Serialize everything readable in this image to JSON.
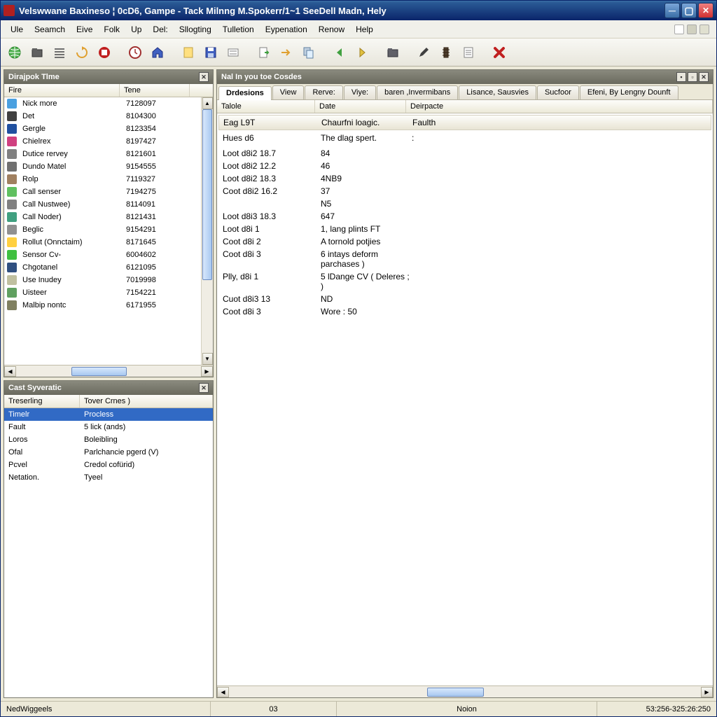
{
  "window": {
    "title": "Velswwane Baxineso ¦ 0cD6, Gampe - Tack Milnng M.Spokerr/1~1 SeeDell Madn, Hely"
  },
  "menu": [
    "Ule",
    "Seamch",
    "Eive",
    "Folk",
    "Up",
    "Del:",
    "Sllogting",
    "Tulletion",
    "Eypenation",
    "Renow",
    "Help"
  ],
  "panels": {
    "left_top": {
      "title": "Dirajpok Tlme",
      "columns": [
        "Fire",
        "Tene"
      ],
      "rows": [
        {
          "icon": "#4aa0e0",
          "name": "Nick more",
          "val": "7128097"
        },
        {
          "icon": "#404040",
          "name": "Det",
          "val": "8104300"
        },
        {
          "icon": "#2050a0",
          "name": "Gergle",
          "val": "8123354"
        },
        {
          "icon": "#d04080",
          "name": "Chielrex",
          "val": "8197427"
        },
        {
          "icon": "#808080",
          "name": "Dutice rervey",
          "val": "8121601"
        },
        {
          "icon": "#707070",
          "name": "Dundo Matel",
          "val": "9154555"
        },
        {
          "icon": "#a08060",
          "name": "Rolp",
          "val": "7119327"
        },
        {
          "icon": "#60c060",
          "name": "Call senser",
          "val": "7194275"
        },
        {
          "icon": "#808080",
          "name": "Call Nustwee)",
          "val": "8114091"
        },
        {
          "icon": "#40a080",
          "name": "Call Noder)",
          "val": "8121431"
        },
        {
          "icon": "#909090",
          "name": "Beglic",
          "val": "9154291"
        },
        {
          "icon": "#ffd040",
          "name": "Rollut (Onnctaim)",
          "val": "8171645"
        },
        {
          "icon": "#40c040",
          "name": "Sensor Cv-",
          "val": "6004602"
        },
        {
          "icon": "#305080",
          "name": "Chgotanel",
          "val": "6121095"
        },
        {
          "icon": "#c0c0a0",
          "name": "Use Inudey",
          "val": "7019998"
        },
        {
          "icon": "#60a060",
          "name": "Uisteer",
          "val": "7154221"
        },
        {
          "icon": "#808060",
          "name": "Malbip nontc",
          "val": "6171955"
        }
      ]
    },
    "left_bottom": {
      "title": "Cast Syveratic",
      "columns": [
        "Treserling",
        "Tover Crnes )"
      ],
      "rows": [
        {
          "name": "Timelr",
          "val": "Procless",
          "sel": true
        },
        {
          "name": "Fault",
          "val": "5 lick (ands)"
        },
        {
          "name": "Loros",
          "val": "Boleibling"
        },
        {
          "name": "Ofal",
          "val": "Parlchancie pgerd (V)"
        },
        {
          "name": "Pcvel",
          "val": "Credol cofürid)"
        },
        {
          "name": "Netation.",
          "val": "Tyeel"
        }
      ]
    },
    "right": {
      "title": "Nal In you toe Cosdes",
      "tabs": [
        "Drdesions",
        "View",
        "Rerve:",
        "Viye:",
        "baren ,Invermibans",
        "Lisance, Sausvies",
        "Sucfoor",
        "Efeni, By Lengny Dounft"
      ],
      "active_tab": 0,
      "columns": [
        "Talole",
        "Date",
        "Deirpacte"
      ],
      "rows": [
        {
          "c1": "Eag L9T",
          "c2": "Chaurfni loagic.",
          "c3": "Faulth",
          "hdr": true
        },
        {
          "c1": "Hues d6",
          "c2": "The dlag spert.",
          "c3": ":"
        },
        {
          "c1": "",
          "c2": "",
          "c3": ""
        },
        {
          "c1": "Loot d8i2 18.7",
          "c2": "84",
          "c3": ""
        },
        {
          "c1": "Loot d8i2 12.2",
          "c2": "46",
          "c3": ""
        },
        {
          "c1": "Loot d8i2 18.3",
          "c2": "4NB9",
          "c3": ""
        },
        {
          "c1": "Coot d8i2 16.2",
          "c2": "37",
          "c3": ""
        },
        {
          "c1": "",
          "c2": "N5",
          "c3": ""
        },
        {
          "c1": "Loot d8i3 18.3",
          "c2": "647",
          "c3": ""
        },
        {
          "c1": "Loot d8i 1",
          "c2": "1, lang plints FT",
          "c3": ""
        },
        {
          "c1": "Coot d8i 2",
          "c2": "A tornold potjies",
          "c3": ""
        },
        {
          "c1": "Coot d8i 3",
          "c2": "6 intays deform parchases )",
          "c3": ""
        },
        {
          "c1": "Plly, d8i 1",
          "c2": "5 lDange CV ( Deleres ; )",
          "c3": ""
        },
        {
          "c1": "Cuot d8i3 13",
          "c2": "ND",
          "c3": ""
        },
        {
          "c1": "Coot d8i 3",
          "c2": "Wore : 50",
          "c3": ""
        }
      ]
    }
  },
  "statusbar": {
    "left": "NedWiggeels",
    "mid1": "03",
    "mid2": "Noion",
    "right": "53:256-325:26:250"
  }
}
